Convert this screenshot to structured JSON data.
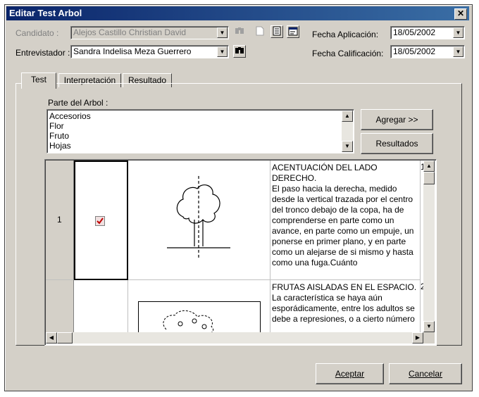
{
  "window": {
    "title": "Editar Test Arbol",
    "close_glyph": "✕"
  },
  "form": {
    "candidato_label": "Candidato :",
    "candidato_value": "Alejos Castillo Christian David",
    "entrevistador_label": "Entrevistador :",
    "entrevistador_value": "Sandra Indelisa Meza Guerrero",
    "fecha_aplicacion_label": "Fecha Aplicación:",
    "fecha_aplicacion_value": "18/05/2002",
    "fecha_calificacion_label": "Fecha Calificación:",
    "fecha_calificacion_value": "18/05/2002"
  },
  "tabs": [
    {
      "label": "Test"
    },
    {
      "label": "Interpretación"
    },
    {
      "label": "Resultado"
    }
  ],
  "parte": {
    "label": "Parte del Arbol :",
    "items": [
      "Accesorios",
      "Flor",
      "Fruto",
      "Hojas"
    ]
  },
  "buttons": {
    "agregar": "Agregar >>",
    "resultados": "Resultados",
    "aceptar": "Aceptar",
    "cancelar": "Cancelar"
  },
  "grid": {
    "rows": [
      {
        "num": "1",
        "checked": true,
        "text": "ACENTUACIÓN DEL LADO DERECHO.\nEl paso hacia la derecha, medido desde la vertical trazada por el centro del tronco debajo de la copa, ha de comprenderse en parte como un avance, en parte como un empuje, un ponerse en primer plano, y en parte como un alejarse de si mismo y hasta como una fuga.Cuánto",
        "side": "1"
      },
      {
        "num": "",
        "checked": false,
        "text": "FRUTAS AISLADAS EN EL ESPACIO.\nLa característica se haya aún esporádicamente, entre los adultos se debe a represiones, o a cierto número",
        "side": "2"
      }
    ]
  },
  "icons": {
    "candidato_arrow": "▼",
    "entrevistador_arrow": "▼",
    "fecha_arrow": "▼",
    "scroll_up": "▲",
    "scroll_down": "▼",
    "scroll_left": "◀",
    "scroll_right": "▶",
    "check": "✔",
    "binoculars": "⚭"
  },
  "colors": {
    "title_bar": "#0a246a",
    "check_mark": "#c00000"
  }
}
